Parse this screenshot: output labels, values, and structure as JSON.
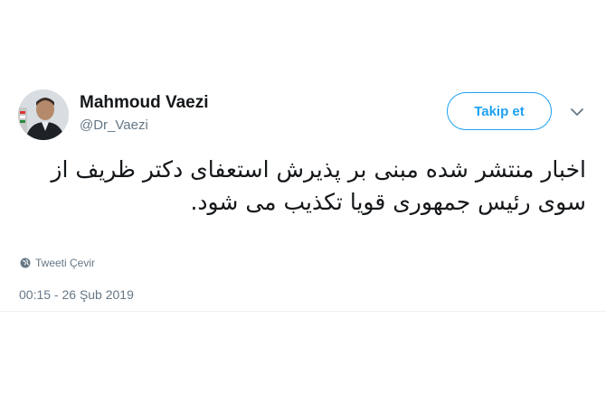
{
  "user": {
    "name": "Mahmoud Vaezi",
    "handle": "@Dr_Vaezi"
  },
  "follow_button": {
    "label": "Takip et"
  },
  "tweet": {
    "text": "اخبار منتشر شده مبنی بر پذیرش استعفای دکتر ظریف از سوی رئیس جمهوری قویا تکذیب می شود.",
    "translate_label": "Tweeti Çevir",
    "timestamp": "00:15 - 26 Şub 2019"
  },
  "colors": {
    "accent": "#1da1f2",
    "secondary_text": "#657786",
    "primary_text": "#14171a"
  },
  "icons": {
    "menu": "chevron-down-icon",
    "translate": "globe-icon"
  }
}
